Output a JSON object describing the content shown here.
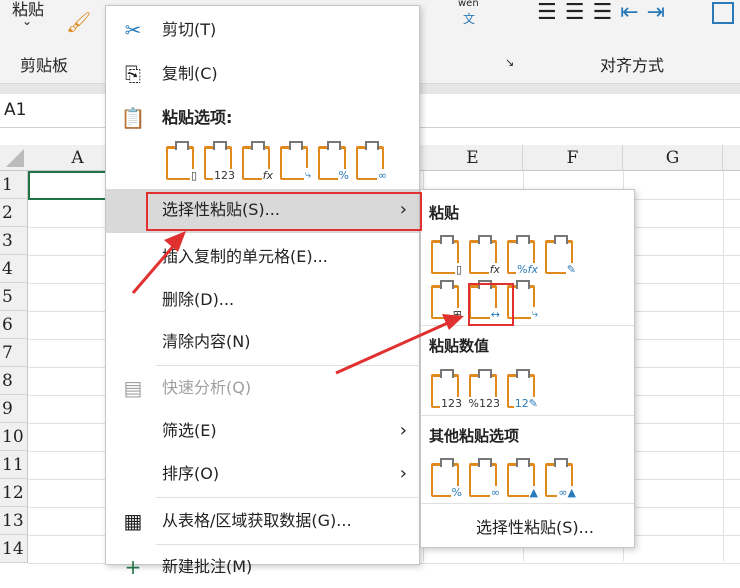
{
  "ribbon": {
    "paste_label": "粘贴",
    "clipboard_group": "剪贴板",
    "align_group": "对齐方式",
    "phonetic": "wén",
    "phonetic_char": "文"
  },
  "name_box": "A1",
  "columns": [
    "A",
    "E",
    "F",
    "G"
  ],
  "rows": [
    "1",
    "2",
    "3",
    "4",
    "5",
    "6",
    "7",
    "8",
    "9",
    "10",
    "11",
    "12",
    "13",
    "14"
  ],
  "menu": {
    "cut": "剪切(T)",
    "copy": "复制(C)",
    "paste_options": "粘贴选项:",
    "paste_icons": [
      "粘贴",
      "值",
      "公式",
      "转置",
      "格式",
      "粘贴链接"
    ],
    "paste_special": "选择性粘贴(S)...",
    "insert_copied": "插入复制的单元格(E)...",
    "delete": "删除(D)...",
    "clear": "清除内容(N)",
    "quick_analysis": "快速分析(Q)",
    "filter": "筛选(E)",
    "sort": "排序(O)",
    "get_data": "从表格/区域获取数据(G)...",
    "new_comment": "新建批注(M)"
  },
  "submenu": {
    "paste_header": "粘贴",
    "paste_icons": [
      "粘贴",
      "公式",
      "公式和数字格式",
      "保留源格式",
      "无边框",
      "保留源列宽",
      "转置"
    ],
    "values_header": "粘贴数值",
    "values_icons": [
      "值",
      "值和数字格式",
      "值和源格式"
    ],
    "other_header": "其他粘贴选项",
    "other_icons": [
      "格式",
      "粘贴链接",
      "图片",
      "链接的图片"
    ],
    "paste_special": "选择性粘贴(S)..."
  },
  "colors": {
    "accent": "#e08a1e",
    "highlight": "#e03030",
    "selected_cell": "#217346"
  }
}
